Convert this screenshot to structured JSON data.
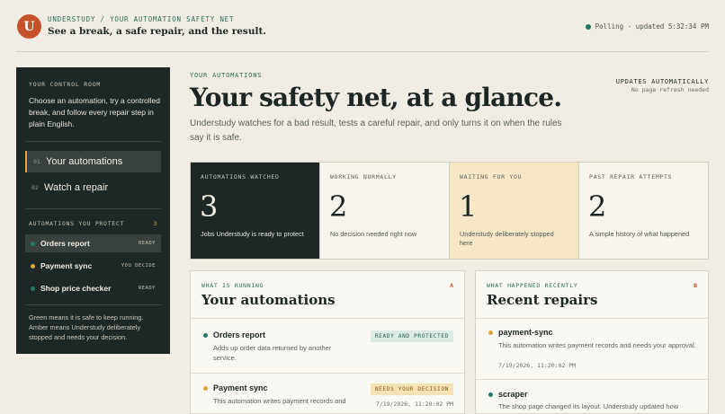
{
  "header": {
    "logo_letter": "U",
    "breadcrumb": "UNDERSTUDY / YOUR AUTOMATION SAFETY NET",
    "tagline": "See a break, a safe repair, and the result.",
    "status": "Polling · updated 5:32:34 PM",
    "status_color": "#1f7a66"
  },
  "sidebar": {
    "kicker": "YOUR CONTROL ROOM",
    "intro": "Choose an automation, try a controlled break, and follow every repair step in plain English.",
    "nav": [
      {
        "num": "01",
        "label": "Your automations",
        "active": true
      },
      {
        "num": "02",
        "label": "Watch a repair",
        "active": false
      }
    ],
    "section_title": "AUTOMATIONS YOU PROTECT",
    "section_count": "3",
    "automations": [
      {
        "name": "Orders report",
        "state": "READY",
        "color": "#1f7a66",
        "active": true
      },
      {
        "name": "Payment sync",
        "state": "YOU DECIDE",
        "color": "#e0a534",
        "active": false
      },
      {
        "name": "Shop price checker",
        "state": "READY",
        "color": "#1f7a66",
        "active": false
      }
    ],
    "legend": "Green means it is safe to keep running. Amber means Understudy deliberately stopped and needs your decision."
  },
  "main": {
    "kicker": "YOUR AUTOMATIONS",
    "title": "Your safety net, at a glance.",
    "lead": "Understudy watches for a bad result, tests a careful repair, and only turns it on when the rules say it is safe.",
    "updates_title": "UPDATES AUTOMATICALLY",
    "updates_sub": "No page refresh needed",
    "stats": [
      {
        "label": "AUTOMATIONS WATCHED",
        "value": "3",
        "desc": "Jobs Understudy is ready to protect"
      },
      {
        "label": "WORKING NORMALLY",
        "value": "2",
        "desc": "No decision needed right now"
      },
      {
        "label": "WAITING FOR YOU",
        "value": "1",
        "desc": "Understudy deliberately stopped here"
      },
      {
        "label": "PAST REPAIR ATTEMPTS",
        "value": "2",
        "desc": "A simple history of what happened"
      }
    ]
  },
  "running": {
    "kicker": "WHAT IS RUNNING",
    "letter": "A",
    "title": "Your automations",
    "items": [
      {
        "name": "Orders report",
        "desc": "Adds up order data returned by another service.",
        "badge": "READY AND PROTECTED",
        "time": ""
      },
      {
        "name": "Payment sync",
        "desc": "This automation writes payment records and",
        "badge": "NEEDS YOUR DECISION",
        "time": "7/19/2026, 11:20:02 PM"
      }
    ]
  },
  "recent": {
    "kicker": "WHAT HAPPENED RECENTLY",
    "letter": "B",
    "title": "Recent repairs",
    "items": [
      {
        "name": "payment-sync",
        "desc": "This automation writes payment records and needs your approval.",
        "time": "7/19/2026, 11:20:02 PM"
      },
      {
        "name": "scraper",
        "desc": "The shop page changed its layout. Understudy updated how",
        "time": ""
      }
    ]
  }
}
